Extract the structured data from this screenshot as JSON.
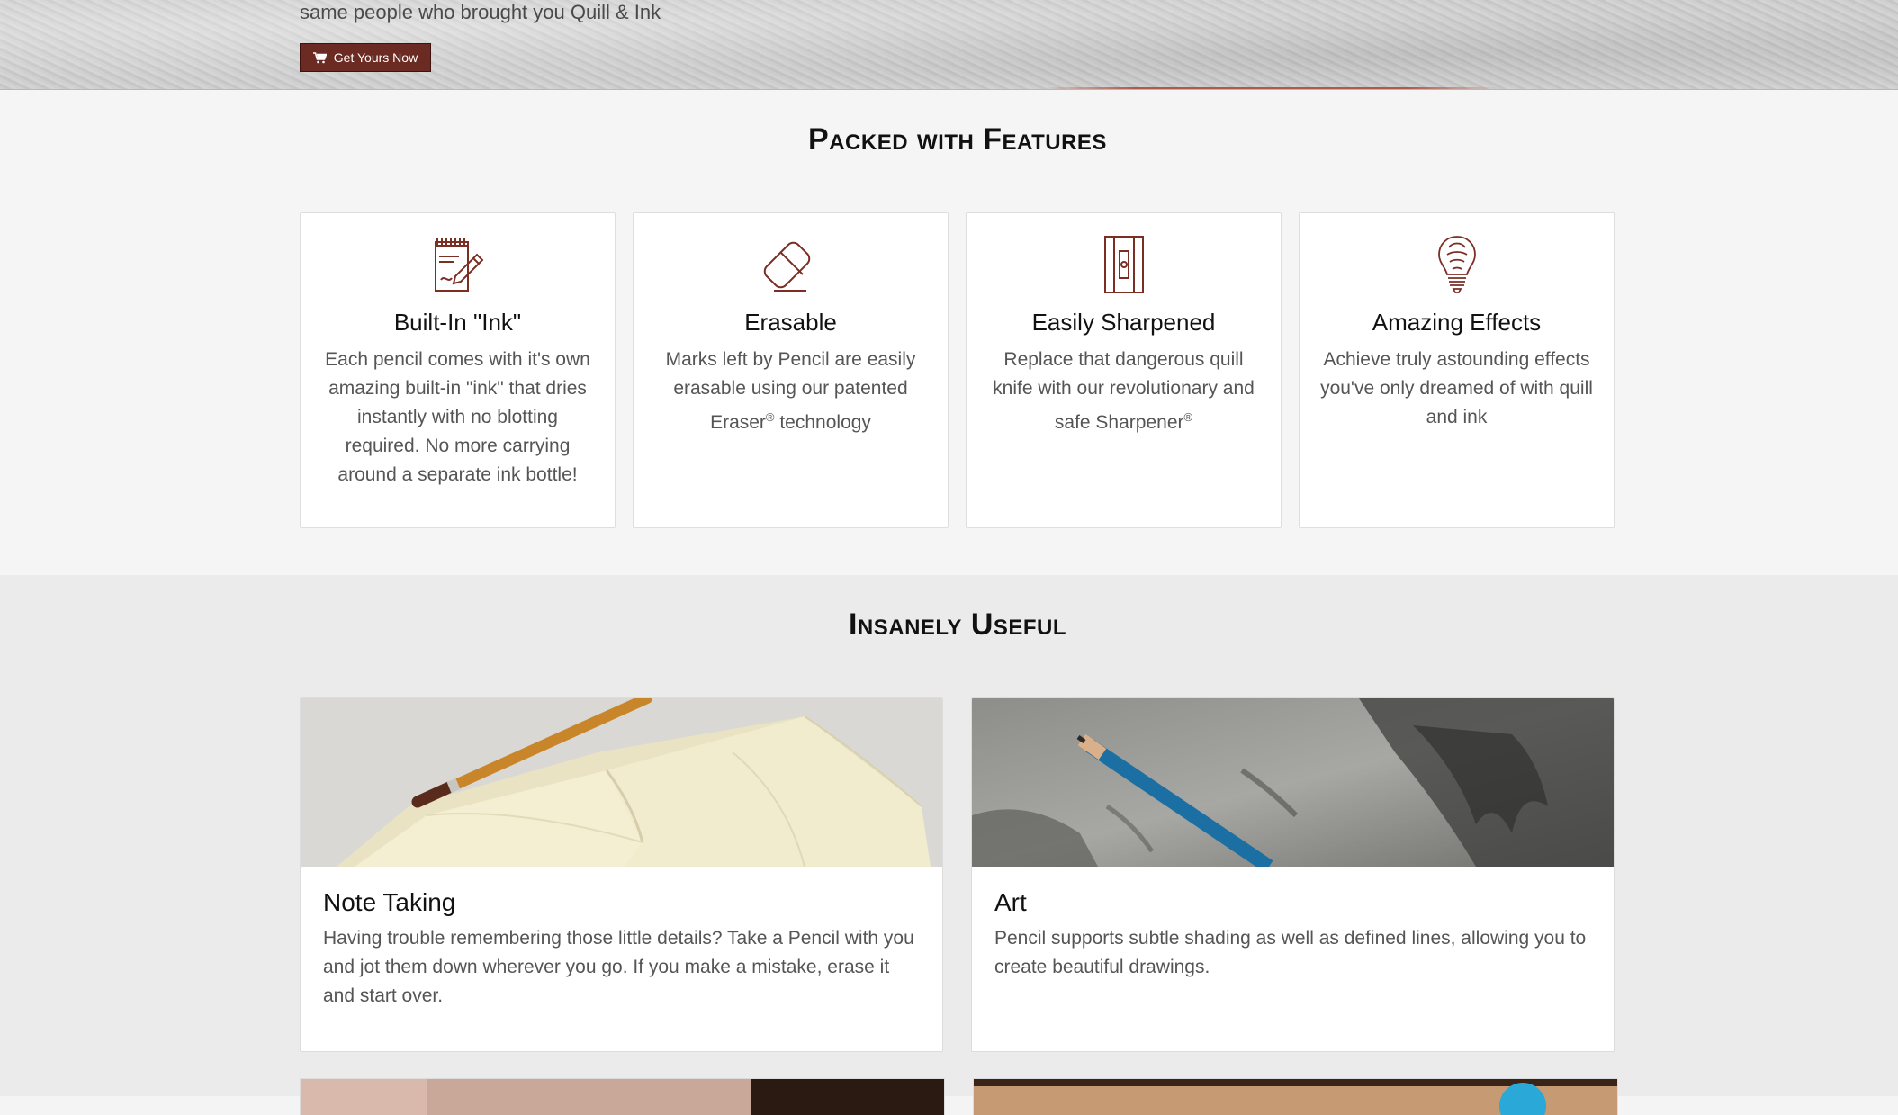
{
  "hero": {
    "subtitle": "same people who brought you Quill & Ink",
    "cta_label": "Get Yours Now",
    "cta_icon": "shopping-cart-icon",
    "brand_color": "#6b2a22"
  },
  "features": {
    "title": "Packed with Features",
    "items": [
      {
        "icon": "notepad-pencil-icon",
        "title": "Built-In \"Ink\"",
        "text": "Each pencil comes with it's own amazing built-in \"ink\" that dries instantly with no blotting required. No more carrying around a separate ink bottle!"
      },
      {
        "icon": "eraser-icon",
        "title": "Erasable",
        "text_before": "Marks left by Pencil are easily erasable using our patented Eraser",
        "sup": "®",
        "text_after": " technology"
      },
      {
        "icon": "sharpener-icon",
        "title": "Easily Sharpened",
        "text_before": "Replace that dangerous quill knife with our revolutionary and safe Sharpener",
        "sup": "®",
        "text_after": ""
      },
      {
        "icon": "lightbulb-icon",
        "title": "Amazing Effects",
        "text": "Achieve truly astounding effects you've only dreamed of with quill and ink"
      }
    ]
  },
  "useful": {
    "title": "Insanely Useful",
    "items": [
      {
        "image": "notebook-with-pencil-photo",
        "title": "Note Taking",
        "text": "Having trouble remembering those little details? Take a Pencil with you and jot them down wherever you go. If you make a mistake, erase it and start over."
      },
      {
        "image": "pencil-drawing-photo",
        "title": "Art",
        "text": "Pencil supports subtle shading as well as defined lines, allowing you to create beautiful drawings."
      }
    ]
  },
  "accent_color": "#6b2a22"
}
